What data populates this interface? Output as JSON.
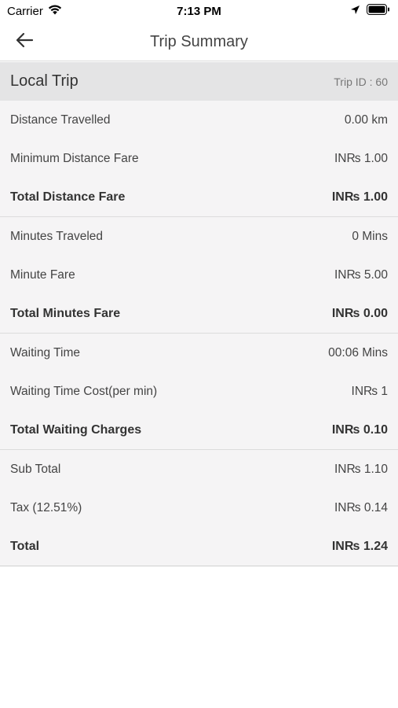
{
  "status_bar": {
    "carrier": "Carrier",
    "time": "7:13 PM"
  },
  "nav": {
    "title": "Trip Summary"
  },
  "summary": {
    "trip_type": "Local Trip",
    "trip_id": "Trip ID : 60",
    "sections": [
      {
        "rows": [
          {
            "label": "Distance Travelled",
            "value": "0.00 km"
          },
          {
            "label": "Minimum Distance Fare",
            "value": "IN₨ 1.00"
          },
          {
            "label": "Total Distance Fare",
            "value": "IN₨ 1.00"
          }
        ]
      },
      {
        "rows": [
          {
            "label": "Minutes Traveled",
            "value": "0 Mins"
          },
          {
            "label": "Minute Fare",
            "value": "IN₨ 5.00"
          },
          {
            "label": "Total Minutes Fare",
            "value": "IN₨ 0.00"
          }
        ]
      },
      {
        "rows": [
          {
            "label": "Waiting Time",
            "value": "00:06 Mins"
          },
          {
            "label": "Waiting Time Cost(per min)",
            "value": "IN₨ 1"
          },
          {
            "label": "Total Waiting Charges",
            "value": "IN₨ 0.10"
          }
        ]
      },
      {
        "rows": [
          {
            "label": "Sub Total",
            "value": "IN₨ 1.10"
          },
          {
            "label": "Tax (12.51%)",
            "value": "IN₨ 0.14"
          },
          {
            "label": "Total",
            "value": "IN₨ 1.24"
          }
        ]
      }
    ]
  }
}
